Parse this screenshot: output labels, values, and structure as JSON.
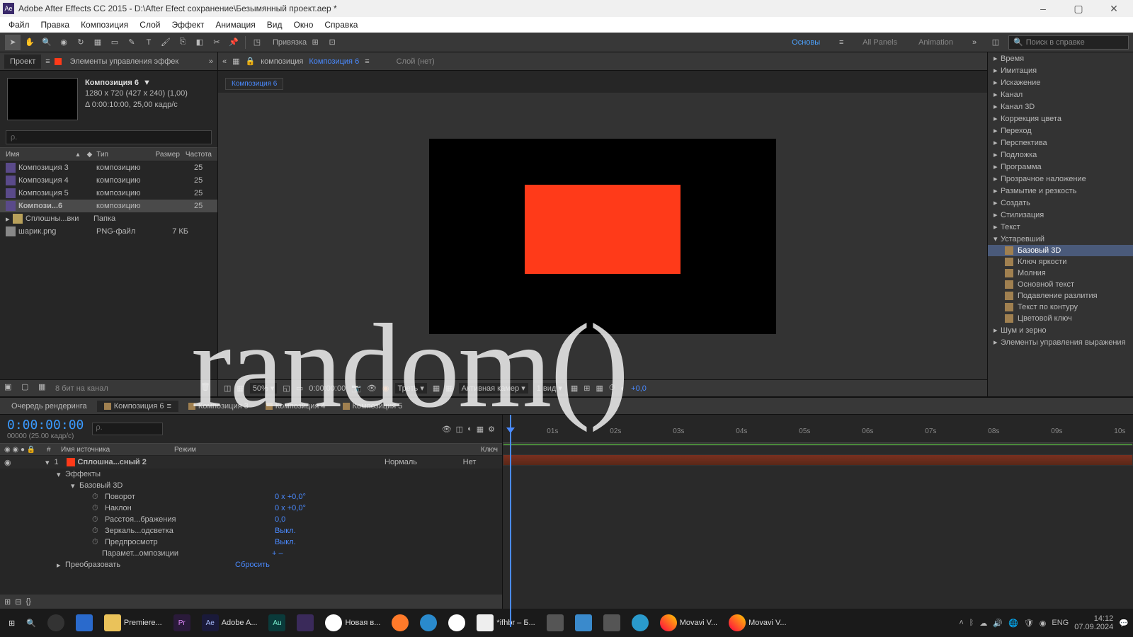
{
  "titlebar": {
    "appIcon": "Ae",
    "title": "Adobe After Effects CC 2015 - D:\\After Efect сохранение\\Безымянный проект.aep *"
  },
  "menubar": [
    "Файл",
    "Правка",
    "Композиция",
    "Слой",
    "Эффект",
    "Анимация",
    "Вид",
    "Окно",
    "Справка"
  ],
  "toolbar": {
    "snapLabel": "Привязка",
    "workspaces": [
      "Основы",
      "All Panels",
      "Animation"
    ],
    "searchPlaceholder": "Поиск в справке"
  },
  "projectPanel": {
    "tabProject": "Проект",
    "tabEffects": "Элементы управления эффек",
    "compName": "Композиция 6",
    "compDims": "1280 x 720  (427 x 240) (1,00)",
    "compDur": "Δ 0:00:10:00, 25,00 кадр/с",
    "searchPlaceholder": "ρ.",
    "cols": {
      "name": "Имя",
      "type": "Тип",
      "size": "Размер",
      "freq": "Частота"
    },
    "rows": [
      {
        "name": "Композиция 3",
        "type": "композицию",
        "freq": "25",
        "kind": "comp"
      },
      {
        "name": "Композиция 4",
        "type": "композицию",
        "freq": "25",
        "kind": "comp"
      },
      {
        "name": "Композиция 5",
        "type": "композицию",
        "freq": "25",
        "kind": "comp"
      },
      {
        "name": "Компози...6",
        "type": "композицию",
        "freq": "25",
        "kind": "comp",
        "selected": true
      },
      {
        "name": "Сплошны...вки",
        "type": "Папка",
        "freq": "",
        "kind": "folder"
      },
      {
        "name": "шарик.png",
        "type": "PNG-файл",
        "size": "7 КБ",
        "kind": "png"
      }
    ],
    "bitDepth": "8 бит на канал"
  },
  "viewer": {
    "breadcrumbComp": "композиция",
    "breadcrumbName": "Композиция 6",
    "layerNone": "Слой (нет)",
    "tabPill": "Композиция 6",
    "footer": {
      "zoom": "50%",
      "time": "0:00:00:00",
      "quality": "Треть",
      "camera": "Активная камер",
      "views": "1 вид",
      "exposure": "+0,0"
    }
  },
  "effectsPanel": {
    "categories": [
      "Время",
      "Имитация",
      "Искажение",
      "Канал",
      "Канал 3D",
      "Коррекция цвета",
      "Переход",
      "Перспектива",
      "Подложка",
      "Программа",
      "Прозрачное наложение",
      "Размытие и резкость",
      "Создать",
      "Стилизация",
      "Текст"
    ],
    "obsolete": {
      "label": "Устаревший",
      "items": [
        "Базовый 3D",
        "Ключ яркости",
        "Молния",
        "Основной текст",
        "Подавление разлития",
        "Текст по контуру",
        "Цветовой ключ"
      ]
    },
    "tail": [
      "Шум и зерно",
      "Элементы управления выражения"
    ]
  },
  "timeline": {
    "tabs": [
      "Очередь рендеринга",
      "Композиция 6",
      "Композиция 3",
      "Композиция 4",
      "Композиция 5"
    ],
    "timecode": "0:00:00:00",
    "framerate": "00000 (25.00 кадр/с)",
    "colSource": "Имя источника",
    "colMode": "Режим",
    "colParent": "Ключ",
    "layer": {
      "index": "1",
      "name": "Сплошна...сный 2",
      "mode": "Нормаль",
      "parent": "Нет"
    },
    "props": {
      "effects": "Эффекты",
      "basic3d": "Базовый 3D",
      "rotation": "Поворот",
      "rotationVal": "0 x +0,0°",
      "tilt": "Наклон",
      "tiltVal": "0 x +0,0°",
      "distance": "Расстоя...бражения",
      "distanceVal": "0,0",
      "specular": "Зеркаль...одсветка",
      "specularVal": "Выкл.",
      "preview": "Предпросмотр",
      "previewVal": "Выкл.",
      "compOpts": "Парамет...омпозиции",
      "compOptsVal": "+  –",
      "transform": "Преобразовать",
      "transformVal": "Сбросить"
    },
    "ticks": [
      "01s",
      "02s",
      "03s",
      "04s",
      "05s",
      "06s",
      "07s",
      "08s",
      "09s",
      "10s"
    ]
  },
  "taskbar": {
    "items": [
      {
        "label": "Premiere..."
      },
      {
        "label": ""
      },
      {
        "label": "Adobe A..."
      },
      {
        "label": ""
      },
      {
        "label": ""
      },
      {
        "label": "Новая в..."
      },
      {
        "label": ""
      },
      {
        "label": ""
      },
      {
        "label": ""
      },
      {
        "label": "*ifhbr – Б..."
      },
      {
        "label": ""
      },
      {
        "label": ""
      },
      {
        "label": ""
      },
      {
        "label": ""
      },
      {
        "label": "Movavi V..."
      },
      {
        "label": "Movavi V..."
      }
    ],
    "lang": "ENG",
    "time": "14:12",
    "date": "07.09.2024"
  },
  "overlay": "random()"
}
